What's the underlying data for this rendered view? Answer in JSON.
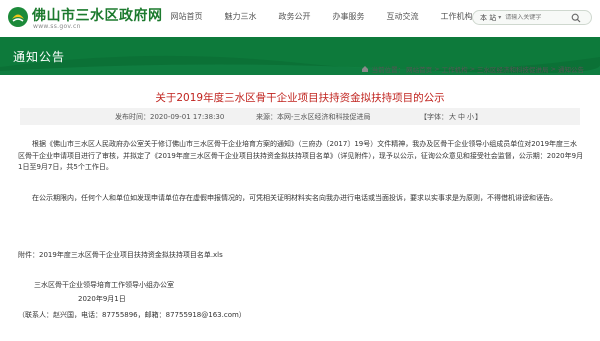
{
  "site": {
    "name": "佛山市三水区政府网",
    "url": "www.ss.gov.cn"
  },
  "nav": {
    "items": [
      {
        "label": "网站首页"
      },
      {
        "label": "魅力三水"
      },
      {
        "label": "政务公开"
      },
      {
        "label": "办事服务"
      },
      {
        "label": "互动交流"
      },
      {
        "label": "工作机构"
      }
    ]
  },
  "search": {
    "scope": "本 站",
    "placeholder": "请输入关键字"
  },
  "banner": {
    "title": "通知公告"
  },
  "breadcrumb": {
    "prefix": "当前位置：",
    "items": [
      "网站首页",
      "工作机构",
      "三水区经济和科技促进局",
      "通知公告"
    ],
    "separator": ">"
  },
  "article": {
    "title": "关于2019年度三水区骨干企业项目扶持资金拟扶持项目的公示",
    "date": "发布时间：2020-09-01 17:38:30",
    "source": "来源：本网-三水区经济和科技促进局",
    "font_label_open": "【字体：",
    "font_sizes": [
      "大",
      "中",
      "小"
    ],
    "font_label_close": "】",
    "paragraph1": "根据《佛山市三水区人民政府办公室关于修订佛山市三水区骨干企业培育方案的通知》（三府办〔2017〕19号）文件精神，我办及区骨干企业领导小组成员单位对2019年度三水区骨干企业申请项目进行了审核，并拟定了《2019年度三水区骨干企业项目扶持资金拟扶持项目名单》（详见附件），现予以公示，征询公众意见和接受社会监督，公示期：2020年9月1日至9月7日，共5个工作日。",
    "paragraph2": "在公示期限内，任何个人和单位如发现申请单位存在虚假申报情况的，可凭相关证明材料实名向我办进行电话或当面投诉，要求以实事求是为原则，不得借机诽谤和诬告。",
    "attachment": "附件：2019年度三水区骨干企业项目扶持资金拟扶持项目名单.xls",
    "signature_office": "三水区骨干企业领导培育工作领导小组办公室",
    "signature_date": "2020年9月1日",
    "contact": "（联系人：赵兴国，电话：87755896，邮箱：87755918@163.com）"
  },
  "colors": {
    "brand_green": "#0d7a3b",
    "title_red": "#c0241f",
    "logo_green": "#1c7a2e"
  }
}
